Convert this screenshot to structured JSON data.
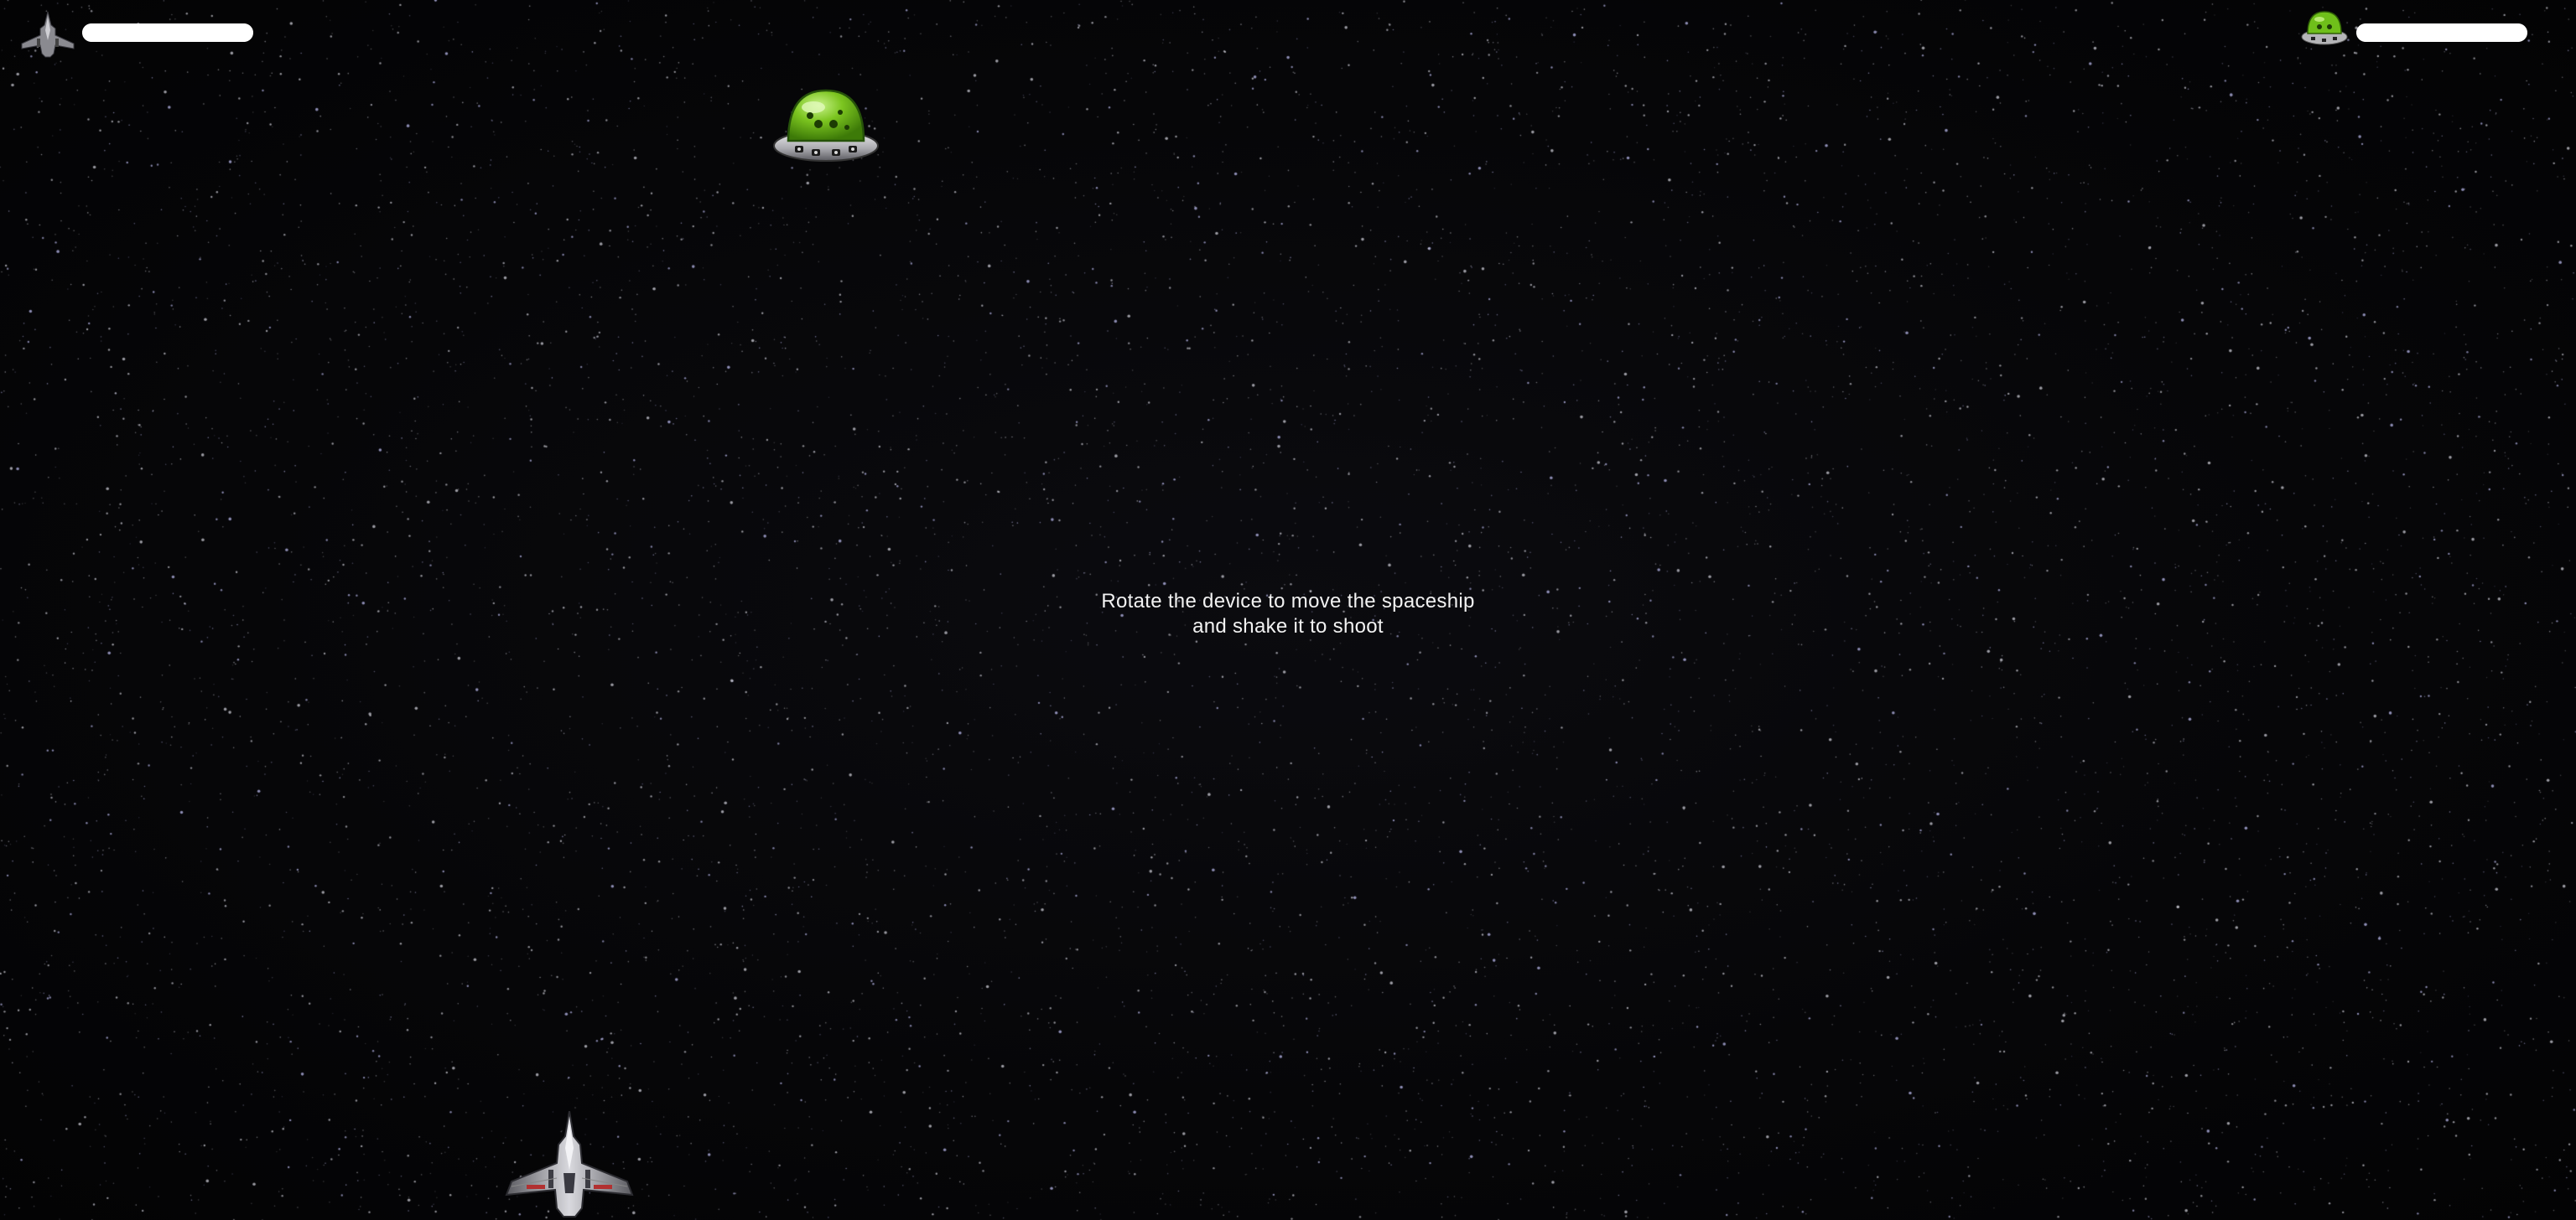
{
  "hud": {
    "player": {
      "icon": "spaceship-icon",
      "health_fraction": 1.0
    },
    "enemy": {
      "icon": "alien-ufo-icon",
      "health_fraction": 1.0
    }
  },
  "instructions": {
    "line1": "Rotate the device to move the spaceship",
    "line2": "and shake it to shoot"
  },
  "sprites": {
    "enemy": "alien-ufo",
    "player": "player-spaceship"
  },
  "colors": {
    "background": "#050506",
    "health_bar": "#ffffff",
    "ufo_dome": "#7cc520",
    "text": "#f2f2f2"
  }
}
